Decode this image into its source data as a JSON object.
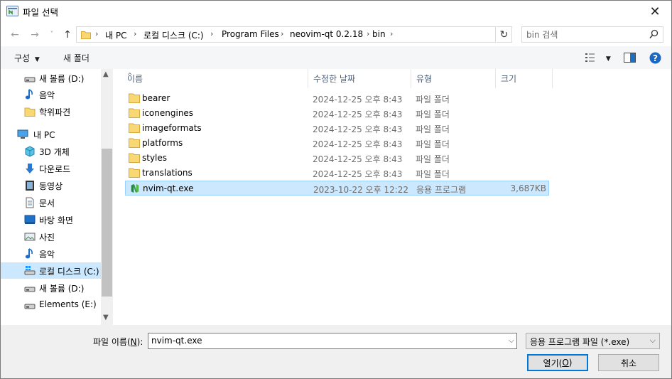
{
  "window": {
    "title": "파일 선택",
    "close_glyph": "✕"
  },
  "nav": {
    "back_glyph": "←",
    "forward_glyph": "→",
    "recent_glyph": "˅",
    "up_glyph": "↑",
    "breadcrumbs": [
      "내 PC",
      "로컬 디스크 (C:)",
      "Program Files",
      "neovim-qt 0.2.18",
      "bin"
    ],
    "refresh_glyph": "↻",
    "search_placeholder": "bin 검색"
  },
  "toolbar": {
    "organize_label": "구성",
    "new_folder_label": "새 폴더"
  },
  "sidebar": {
    "items": [
      {
        "label": "새 볼륨 (D:)",
        "icon": "drive-icon",
        "level": 2
      },
      {
        "label": "음악",
        "icon": "music-icon",
        "level": 2
      },
      {
        "label": "학위파견",
        "icon": "folder-icon",
        "level": 2
      },
      {
        "label": "내 PC",
        "icon": "pc-icon",
        "level": 1
      },
      {
        "label": "3D 개체",
        "icon": "3d-objects-icon",
        "level": 2
      },
      {
        "label": "다운로드",
        "icon": "download-icon",
        "level": 2
      },
      {
        "label": "동영상",
        "icon": "video-icon",
        "level": 2
      },
      {
        "label": "문서",
        "icon": "document-icon",
        "level": 2
      },
      {
        "label": "바탕 화면",
        "icon": "desktop-icon",
        "level": 2
      },
      {
        "label": "사진",
        "icon": "pictures-icon",
        "level": 2
      },
      {
        "label": "음악",
        "icon": "music-icon",
        "level": 2
      },
      {
        "label": "로컬 디스크 (C:)",
        "icon": "windows-drive-icon",
        "level": 2,
        "selected": true
      },
      {
        "label": "새 볼륨 (D:)",
        "icon": "drive-icon",
        "level": 2
      },
      {
        "label": "Elements (E:)",
        "icon": "drive-icon",
        "level": 2
      }
    ]
  },
  "columns": {
    "name": "이름",
    "date": "수정한 날짜",
    "type": "유형",
    "size": "크기"
  },
  "files": [
    {
      "name": "bearer",
      "date": "2024-12-25 오후 8:43",
      "type": "파일 폴더",
      "size": "",
      "icon": "folder-icon"
    },
    {
      "name": "iconengines",
      "date": "2024-12-25 오후 8:43",
      "type": "파일 폴더",
      "size": "",
      "icon": "folder-icon"
    },
    {
      "name": "imageformats",
      "date": "2024-12-25 오후 8:43",
      "type": "파일 폴더",
      "size": "",
      "icon": "folder-icon"
    },
    {
      "name": "platforms",
      "date": "2024-12-25 오후 8:43",
      "type": "파일 폴더",
      "size": "",
      "icon": "folder-icon"
    },
    {
      "name": "styles",
      "date": "2024-12-25 오후 8:43",
      "type": "파일 폴더",
      "size": "",
      "icon": "folder-icon"
    },
    {
      "name": "translations",
      "date": "2024-12-25 오후 8:43",
      "type": "파일 폴더",
      "size": "",
      "icon": "folder-icon"
    },
    {
      "name": "nvim-qt.exe",
      "date": "2023-10-22 오후 12:22",
      "type": "응용 프로그램",
      "size": "3,687KB",
      "icon": "neovim-icon",
      "selected": true
    }
  ],
  "footer": {
    "filename_label_prefix": "파일 이름(",
    "filename_label_key": "N",
    "filename_label_suffix": "):",
    "filename_value": "nvim-qt.exe",
    "filter_value": "응용 프로그램 파일 (*.exe)",
    "open_prefix": "열기(",
    "open_key": "O",
    "open_suffix": ")",
    "cancel_label": "취소"
  },
  "colors": {
    "selection": "#cce8ff",
    "accent": "#0078d7",
    "folder": "#f8d775"
  }
}
